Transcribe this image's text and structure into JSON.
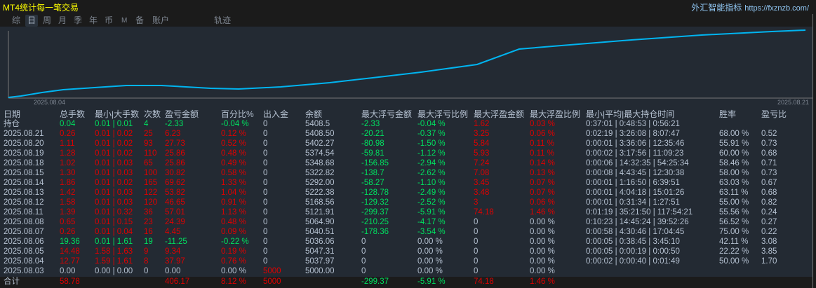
{
  "title": "MT4统计每一笔交易",
  "brand": {
    "name": "外汇智能指标",
    "url": "https://fxznzb.com/"
  },
  "toolbar": [
    "综",
    "日",
    "周",
    "月",
    "季",
    "年",
    "币",
    "M",
    "备",
    "账户",
    "轨迹"
  ],
  "active_tab": "日",
  "chart": {
    "start_label": "2025.08.04",
    "end_label": "2025.08.21",
    "line_color": "#00b4f0"
  },
  "headers": [
    "日期",
    "总手数",
    "最小|大手数",
    "次数",
    "盈亏金额",
    "百分比%",
    "出入金",
    "余额",
    "最大浮亏金额",
    "最大浮亏比例",
    "最大浮盈金额",
    "最大浮盈比例",
    "最小|平均|最大持仓时间",
    "胜率",
    "盈亏比"
  ],
  "rows": [
    {
      "tone": "neg",
      "cells": [
        "持仓",
        "0.04",
        "0.01 | 0.01",
        "4",
        "-2.33",
        "-0.04 %",
        "0",
        "5408.5",
        "-2.33",
        "-0.04 %",
        "1.62",
        "0.03 %",
        "0:37:01 | 0:48:53 | 0:56:21",
        "",
        ""
      ]
    },
    {
      "tone": "pos",
      "cells": [
        "2025.08.21",
        "0.26",
        "0.01 | 0.02",
        "25",
        "6.23",
        "0.12 %",
        "0",
        "5408.50",
        "-20.21",
        "-0.37 %",
        "3.25",
        "0.06 %",
        "0:02:19 | 3:26:08 | 8:07:47",
        "68.00 %",
        "0.52"
      ]
    },
    {
      "tone": "pos",
      "cells": [
        "2025.08.20",
        "1.11",
        "0.01 | 0.02",
        "93",
        "27.73",
        "0.52 %",
        "0",
        "5402.27",
        "-80.98",
        "-1.50 %",
        "5.84",
        "0.11 %",
        "0:00:01 | 3:36:06 | 12:35:46",
        "55.91 %",
        "0.73"
      ]
    },
    {
      "tone": "pos",
      "cells": [
        "2025.08.19",
        "1.28",
        "0.01 | 0.02",
        "110",
        "25.86",
        "0.48 %",
        "0",
        "5374.54",
        "-59.81",
        "-1.12 %",
        "5.93",
        "0.11 %",
        "0:00:02 | 3:17:56 | 11:09:23",
        "60.00 %",
        "0.68"
      ]
    },
    {
      "tone": "pos",
      "cells": [
        "2025.08.18",
        "1.02",
        "0.01 | 0.03",
        "65",
        "25.86",
        "0.49 %",
        "0",
        "5348.68",
        "-156.85",
        "-2.94 %",
        "7.24",
        "0.14 %",
        "0:00:06 | 14:32:35 | 54:25:34",
        "58.46 %",
        "0.71"
      ]
    },
    {
      "tone": "pos",
      "cells": [
        "2025.08.15",
        "1.30",
        "0.01 | 0.03",
        "100",
        "30.82",
        "0.58 %",
        "0",
        "5322.82",
        "-138.7",
        "-2.62 %",
        "7.08",
        "0.13 %",
        "0:00:08 | 4:43:45 | 12:30:38",
        "58.00 %",
        "0.73"
      ]
    },
    {
      "tone": "pos",
      "cells": [
        "2025.08.14",
        "1.86",
        "0.01 | 0.02",
        "165",
        "69.62",
        "1.33 %",
        "0",
        "5292.00",
        "-58.27",
        "-1.10 %",
        "3.45",
        "0.07 %",
        "0:00:01 | 1:16:50 | 6:39:51",
        "63.03 %",
        "0.67"
      ]
    },
    {
      "tone": "pos",
      "cells": [
        "2025.08.13",
        "1.42",
        "0.01 | 0.03",
        "122",
        "53.82",
        "1.04 %",
        "0",
        "5222.38",
        "-128.78",
        "-2.49 %",
        "3.48",
        "0.07 %",
        "0:00:01 | 4:04:18 | 15:01:26",
        "63.11 %",
        "0.68"
      ]
    },
    {
      "tone": "pos",
      "cells": [
        "2025.08.12",
        "1.58",
        "0.01 | 0.03",
        "120",
        "46.65",
        "0.91 %",
        "0",
        "5168.56",
        "-129.32",
        "-2.52 %",
        "3",
        "0.06 %",
        "0:00:01 | 0:31:34 | 1:27:51",
        "55.00 %",
        "0.82"
      ]
    },
    {
      "tone": "pos",
      "cells": [
        "2025.08.11",
        "1.39",
        "0.01 | 0.32",
        "36",
        "57.01",
        "1.13 %",
        "0",
        "5121.91",
        "-299.37",
        "-5.91 %",
        "74.18",
        "1.46 %",
        "0:01:19 | 35:21:50 | 117:54:21",
        "55.56 %",
        "0.24"
      ]
    },
    {
      "tone": "pos",
      "cells": [
        "2025.08.08",
        "0.65",
        "0.01 | 0.15",
        "23",
        "24.39",
        "0.48 %",
        "0",
        "5064.90",
        "-210.25",
        "-4.17 %",
        "0",
        "0.00 %",
        "0:10:23 | 14:45:24 | 39:52:26",
        "56.52 %",
        "0.27"
      ]
    },
    {
      "tone": "pos",
      "cells": [
        "2025.08.07",
        "0.26",
        "0.01 | 0.04",
        "16",
        "4.45",
        "0.09 %",
        "0",
        "5040.51",
        "-178.36",
        "-3.54 %",
        "0",
        "0.00 %",
        "0:00:58 | 4:30:46 | 17:04:45",
        "75.00 %",
        "0.22"
      ]
    },
    {
      "tone": "neg",
      "cells": [
        "2025.08.06",
        "19.36",
        "0.01 | 1.61",
        "19",
        "-11.25",
        "-0.22 %",
        "0",
        "5036.06",
        "0",
        "0.00 %",
        "0",
        "0.00 %",
        "0:00:05 | 0:38:45 | 3:45:10",
        "42.11 %",
        "3.08"
      ]
    },
    {
      "tone": "pos",
      "cells": [
        "2025.08.05",
        "14.48",
        "1.58 | 1.63",
        "9",
        "9.34",
        "0.19 %",
        "0",
        "5047.31",
        "0",
        "0.00 %",
        "0",
        "0.00 %",
        "0:00:05 | 0:00:19 | 0:00:50",
        "22.22 %",
        "3.85"
      ]
    },
    {
      "tone": "pos",
      "cells": [
        "2025.08.04",
        "12.77",
        "1.59 | 1.61",
        "8",
        "37.97",
        "0.76 %",
        "0",
        "5037.97",
        "0",
        "0.00 %",
        "0",
        "0.00 %",
        "0:00:02 | 0:00:40 | 0:01:49",
        "50.00 %",
        "1.70"
      ]
    },
    {
      "tone": "flat",
      "cells": [
        "2025.08.03",
        "0.00",
        "0.00 | 0.00",
        "0",
        "0.00",
        "0.00 %",
        "5000",
        "5000.00",
        "0",
        "0.00 %",
        "0",
        "0.00 %",
        "",
        "",
        ""
      ]
    }
  ],
  "footer": {
    "tone": "pos",
    "cells": [
      "合计",
      "58.78",
      "",
      "",
      "406.17",
      "8.12 %",
      "5000",
      "",
      "-299.37",
      "-5.91 %",
      "74.18",
      "1.46 %",
      "",
      "",
      ""
    ]
  }
}
